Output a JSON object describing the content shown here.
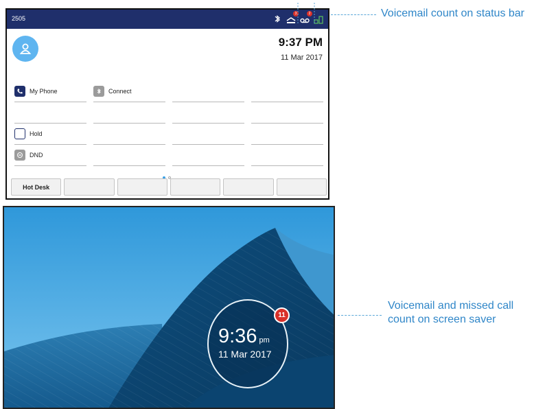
{
  "phone": {
    "extension": "2505",
    "status_icons": [
      "bluetooth-icon",
      "voicemail-icon",
      "missed-call-icon",
      "network-icon"
    ],
    "voicemail_badge": "3",
    "missed_badge": "2",
    "time": "9:37 PM",
    "date": "11 Mar 2017",
    "line_keys": [
      {
        "label": "My Phone",
        "icon": "phone-icon"
      },
      {
        "label": "Connect",
        "icon": "bluetooth-icon"
      },
      {
        "label": "Hold",
        "icon": "hold-icon"
      },
      {
        "label": "DND",
        "icon": "dnd-icon"
      }
    ],
    "page_dots": {
      "count": 2,
      "active": 1
    },
    "softkeys": [
      "Hot Desk",
      "",
      "",
      "",
      "",
      ""
    ]
  },
  "callouts": {
    "status_bar": "Voicemail count on status bar",
    "screen_saver": "Voicemail and missed call count on screen saver"
  },
  "screen_saver": {
    "time": "9:36",
    "ampm": "pm",
    "date": "11 Mar 2017",
    "badge": "11"
  },
  "colors": {
    "status_bar": "#1f2f6b",
    "accent": "#3aa0e6",
    "badge": "#d9312a",
    "callout_text": "#2f86c8"
  }
}
